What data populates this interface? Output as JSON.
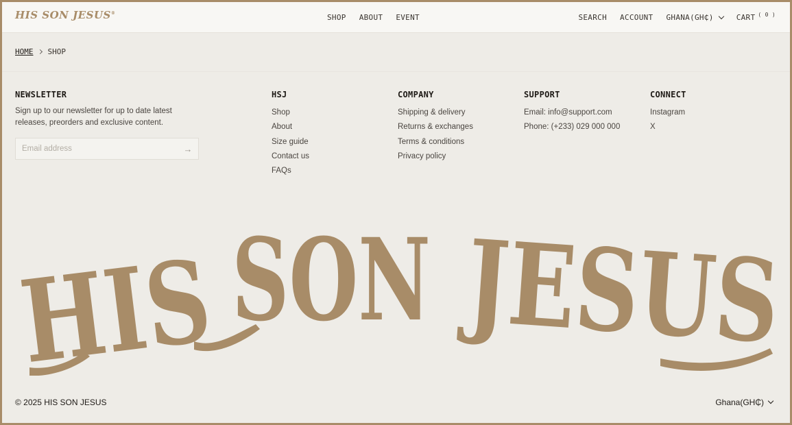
{
  "header": {
    "logo": "HIS SON JESUS",
    "logo_mark": "®",
    "nav_center": [
      "SHOP",
      "ABOUT",
      "EVENT"
    ],
    "search": "SEARCH",
    "account": "ACCOUNT",
    "country": "GHANA(GH₵)",
    "cart": "CART",
    "cart_count": "( 0 )"
  },
  "breadcrumb": {
    "home": "HOME",
    "current": "SHOP"
  },
  "newsletter": {
    "title": "NEWSLETTER",
    "description": "Sign up to our newsletter for up to date latest releases, preorders and exclusive content.",
    "placeholder": "Email address"
  },
  "columns": {
    "hsj": {
      "title": "HSJ",
      "links": [
        "Shop",
        "About",
        "Size guide",
        "Contact us",
        "FAQs"
      ]
    },
    "company": {
      "title": "COMPANY",
      "links": [
        "Shipping & delivery",
        "Returns & exchanges",
        "Terms & conditions",
        "Privacy policy"
      ]
    },
    "support": {
      "title": "SUPPORT",
      "links": [
        "Email: info@support.com",
        "Phone: (+233) 029 000 000"
      ]
    },
    "connect": {
      "title": "CONNECT",
      "links": [
        "Instagram",
        "X"
      ]
    }
  },
  "wordmark": {
    "words": [
      "HIS",
      "SON",
      "JESUS"
    ],
    "color": "#a88c68"
  },
  "footer": {
    "copyright": "© 2025 HIS SON JESUS",
    "country": "Ghana(GH₵)"
  },
  "colors": {
    "accent": "#a88c68",
    "background": "#eeece7",
    "header_bg": "#f8f7f4"
  }
}
